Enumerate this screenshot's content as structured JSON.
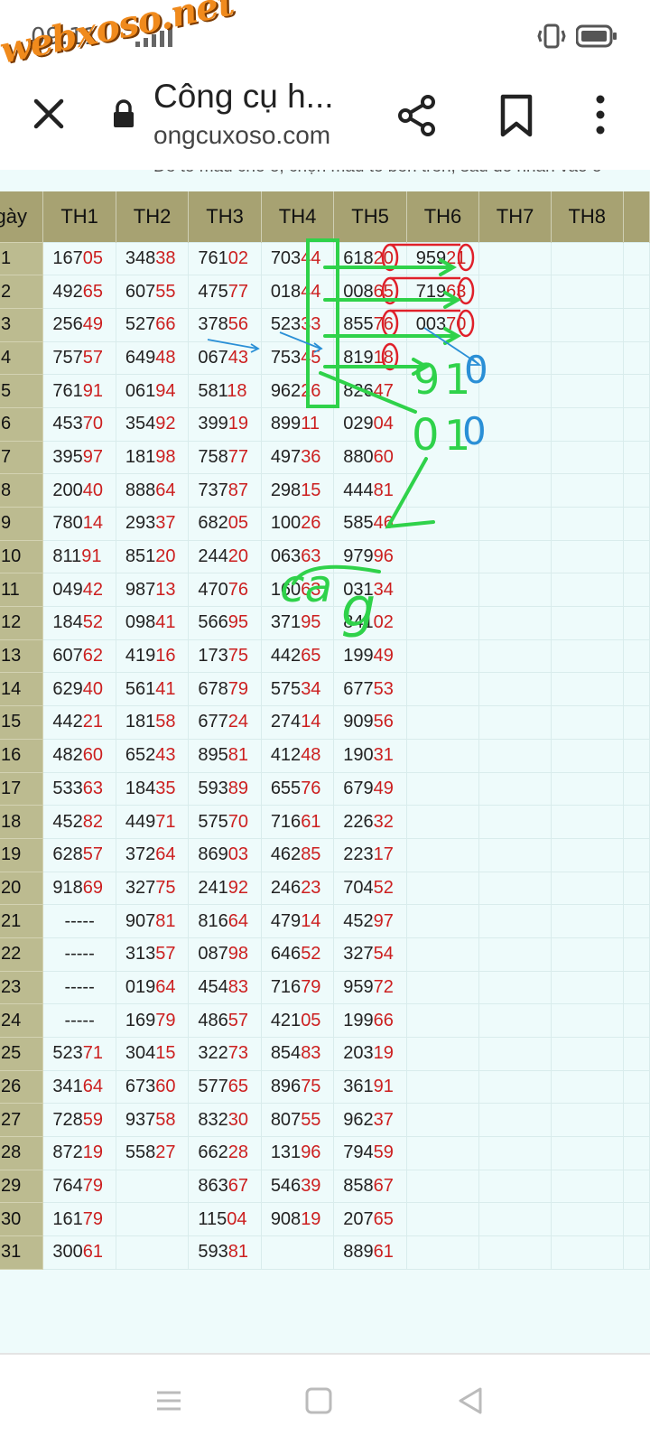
{
  "status": {
    "time": "09:11"
  },
  "watermark": "webxoso.net",
  "browser": {
    "title": "Công cụ h...",
    "url": "ongcuxoso.com"
  },
  "hint": "Để tô màu cho ô, chọn màu tô bên trên, sau đó nhấn vào ô",
  "table": {
    "headers": [
      "gày",
      "TH1",
      "TH2",
      "TH3",
      "TH4",
      "TH5",
      "TH6",
      "TH7",
      "TH8"
    ],
    "rows": [
      [
        "1",
        "16705",
        "34838",
        "76102",
        "70344",
        "61820",
        "95921",
        "",
        ""
      ],
      [
        "2",
        "49265",
        "60755",
        "47577",
        "01844",
        "00865",
        "71963",
        "",
        ""
      ],
      [
        "3",
        "25649",
        "52766",
        "37856",
        "52333",
        "85576",
        "00370",
        "",
        ""
      ],
      [
        "4",
        "75757",
        "64948",
        "06743",
        "75345",
        "81918",
        "",
        "",
        ""
      ],
      [
        "5",
        "76191",
        "06194",
        "58118",
        "96226",
        "82647",
        "",
        "",
        ""
      ],
      [
        "6",
        "45370",
        "35492",
        "39919",
        "89911",
        "02904",
        "",
        "",
        ""
      ],
      [
        "7",
        "39597",
        "18198",
        "75877",
        "49736",
        "88060",
        "",
        "",
        ""
      ],
      [
        "8",
        "20040",
        "88864",
        "73787",
        "29815",
        "44481",
        "",
        "",
        ""
      ],
      [
        "9",
        "78014",
        "29337",
        "68205",
        "10026",
        "58546",
        "",
        "",
        ""
      ],
      [
        "10",
        "81191",
        "85120",
        "24420",
        "06363",
        "97996",
        "",
        "",
        ""
      ],
      [
        "11",
        "04942",
        "98713",
        "47076",
        "16063",
        "03134",
        "",
        "",
        ""
      ],
      [
        "12",
        "18452",
        "09841",
        "56695",
        "37195",
        "84102",
        "",
        "",
        ""
      ],
      [
        "13",
        "60762",
        "41916",
        "17375",
        "44265",
        "19949",
        "",
        "",
        ""
      ],
      [
        "14",
        "62940",
        "56141",
        "67879",
        "57534",
        "67753",
        "",
        "",
        ""
      ],
      [
        "15",
        "44221",
        "18158",
        "67724",
        "27414",
        "90956",
        "",
        "",
        ""
      ],
      [
        "16",
        "48260",
        "65243",
        "89581",
        "41248",
        "19031",
        "",
        "",
        ""
      ],
      [
        "17",
        "53363",
        "18435",
        "59389",
        "65576",
        "67949",
        "",
        "",
        ""
      ],
      [
        "18",
        "45282",
        "44971",
        "57570",
        "71661",
        "22632",
        "",
        "",
        ""
      ],
      [
        "19",
        "62857",
        "37264",
        "86903",
        "46285",
        "22317",
        "",
        "",
        ""
      ],
      [
        "20",
        "91869",
        "32775",
        "24192",
        "24623",
        "70452",
        "",
        "",
        ""
      ],
      [
        "21",
        "-----",
        "90781",
        "81664",
        "47914",
        "45297",
        "",
        "",
        ""
      ],
      [
        "22",
        "-----",
        "31357",
        "08798",
        "64652",
        "32754",
        "",
        "",
        ""
      ],
      [
        "23",
        "-----",
        "01964",
        "45483",
        "71679",
        "95972",
        "",
        "",
        ""
      ],
      [
        "24",
        "-----",
        "16979",
        "48657",
        "42105",
        "19966",
        "",
        "",
        ""
      ],
      [
        "25",
        "52371",
        "30415",
        "32273",
        "85483",
        "20319",
        "",
        "",
        ""
      ],
      [
        "26",
        "34164",
        "67360",
        "57765",
        "89675",
        "36191",
        "",
        "",
        ""
      ],
      [
        "27",
        "72859",
        "93758",
        "83230",
        "80755",
        "96237",
        "",
        "",
        ""
      ],
      [
        "28",
        "87219",
        "55827",
        "66228",
        "13196",
        "79459",
        "",
        "",
        ""
      ],
      [
        "29",
        "76479",
        "",
        "86367",
        "54639",
        "85867",
        "",
        "",
        ""
      ],
      [
        "30",
        "16179",
        "",
        "11504",
        "90819",
        "20765",
        "",
        "",
        ""
      ],
      [
        "31",
        "30061",
        "",
        "59381",
        "",
        "88961",
        "",
        "",
        ""
      ]
    ]
  },
  "annotations": {
    "green_marks": [
      "9",
      "1",
      "0",
      "1",
      "ca",
      "g"
    ],
    "blue_marks": [
      "0",
      "0"
    ]
  },
  "colors": {
    "header_bg": "#a7a272",
    "day_bg": "#bcbb90",
    "cell_bg": "#eefbfb",
    "highlight": "#cc1f1f",
    "green_pen": "#2fd24a",
    "red_pen": "#e0202a",
    "blue_pen": "#2a8fd6"
  }
}
